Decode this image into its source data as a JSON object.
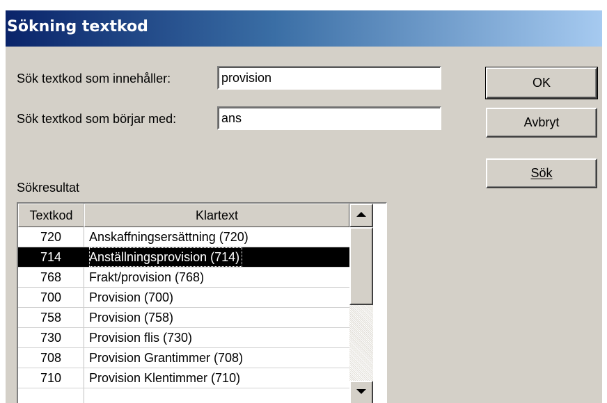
{
  "window": {
    "title": "Sökning textkod"
  },
  "form": {
    "contains_label": "Sök textkod som innehåller:",
    "contains_value": "provision",
    "starts_label": "Sök textkod som börjar med:",
    "starts_value": "ans"
  },
  "buttons": {
    "ok": "OK",
    "cancel": "Avbryt",
    "search": "Sök"
  },
  "results": {
    "label": "Sökresultat",
    "columns": [
      "Textkod",
      "Klartext"
    ],
    "rows": [
      {
        "code": "720",
        "text": "Anskaffningsersättning (720)"
      },
      {
        "code": "714",
        "text": "Anställningsprovision (714)",
        "selected": true
      },
      {
        "code": "768",
        "text": "Frakt/provision (768)"
      },
      {
        "code": "700",
        "text": "Provision (700)"
      },
      {
        "code": "758",
        "text": "Provision (758)"
      },
      {
        "code": "730",
        "text": "Provision flis (730)"
      },
      {
        "code": "708",
        "text": "Provision Grantimmer (708)"
      },
      {
        "code": "710",
        "text": "Provision Klentimmer (710)"
      }
    ]
  },
  "colors": {
    "dialog_bg": "#d4d0c8",
    "title_start": "#0a246a",
    "title_end": "#a6caf0",
    "selected_bg": "#000000"
  }
}
